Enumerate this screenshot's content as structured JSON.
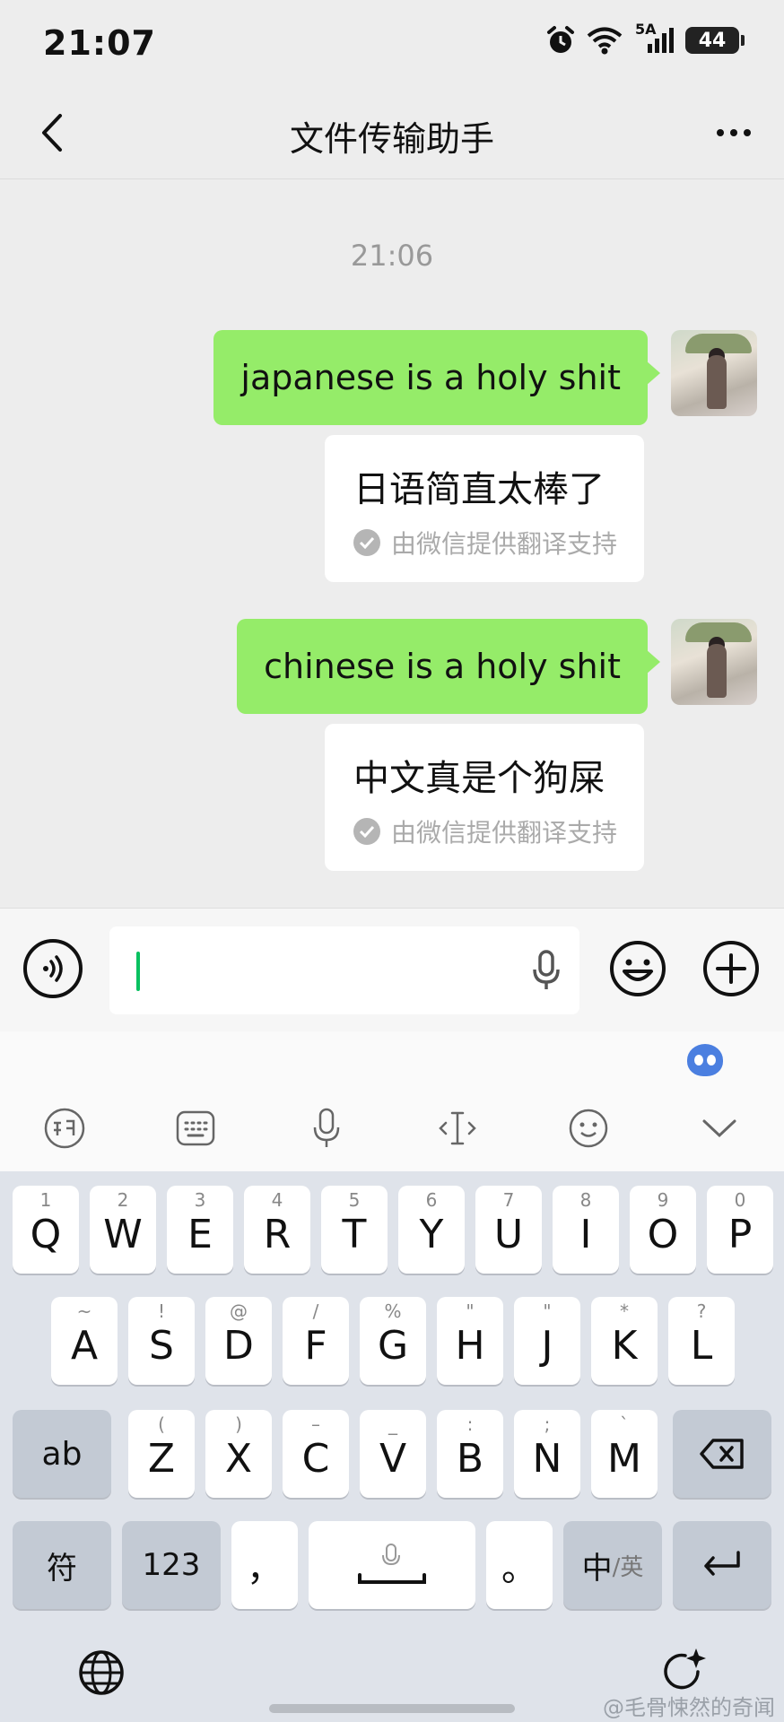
{
  "status_bar": {
    "time": "21:07",
    "signal_label": "5A",
    "battery": "44"
  },
  "nav": {
    "title": "文件传输助手"
  },
  "chat": {
    "timestamp": "21:06",
    "messages": [
      {
        "text": "japanese is a holy shit",
        "translation": "日语简直太棒了",
        "translation_note": "由微信提供翻译支持"
      },
      {
        "text": "chinese is a holy shit",
        "translation": "中文真是个狗屎",
        "translation_note": "由微信提供翻译支持"
      }
    ]
  },
  "input": {
    "value": ""
  },
  "keyboard": {
    "row1": [
      {
        "hint": "1",
        "label": "Q"
      },
      {
        "hint": "2",
        "label": "W"
      },
      {
        "hint": "3",
        "label": "E"
      },
      {
        "hint": "4",
        "label": "R"
      },
      {
        "hint": "5",
        "label": "T"
      },
      {
        "hint": "6",
        "label": "Y"
      },
      {
        "hint": "7",
        "label": "U"
      },
      {
        "hint": "8",
        "label": "I"
      },
      {
        "hint": "9",
        "label": "O"
      },
      {
        "hint": "0",
        "label": "P"
      }
    ],
    "row2": [
      {
        "hint": "~",
        "label": "A"
      },
      {
        "hint": "!",
        "label": "S"
      },
      {
        "hint": "@",
        "label": "D"
      },
      {
        "hint": "/",
        "label": "F"
      },
      {
        "hint": "%",
        "label": "G"
      },
      {
        "hint": "\"",
        "label": "H"
      },
      {
        "hint": "\"",
        "label": "J"
      },
      {
        "hint": "*",
        "label": "K"
      },
      {
        "hint": "?",
        "label": "L"
      }
    ],
    "row3": [
      {
        "hint": "(",
        "label": "Z"
      },
      {
        "hint": ")",
        "label": "X"
      },
      {
        "hint": "–",
        "label": "C"
      },
      {
        "hint": "_",
        "label": "V"
      },
      {
        "hint": ":",
        "label": "B"
      },
      {
        "hint": ";",
        "label": "N"
      },
      {
        "hint": "`",
        "label": "M"
      }
    ],
    "shift_label": "ab",
    "symbol_label": "符",
    "num_label": "123",
    "comma_label": "，",
    "period_label": "。",
    "lang_zh": "中",
    "lang_en": "/英"
  },
  "watermark": "@毛骨悚然的奇闻"
}
